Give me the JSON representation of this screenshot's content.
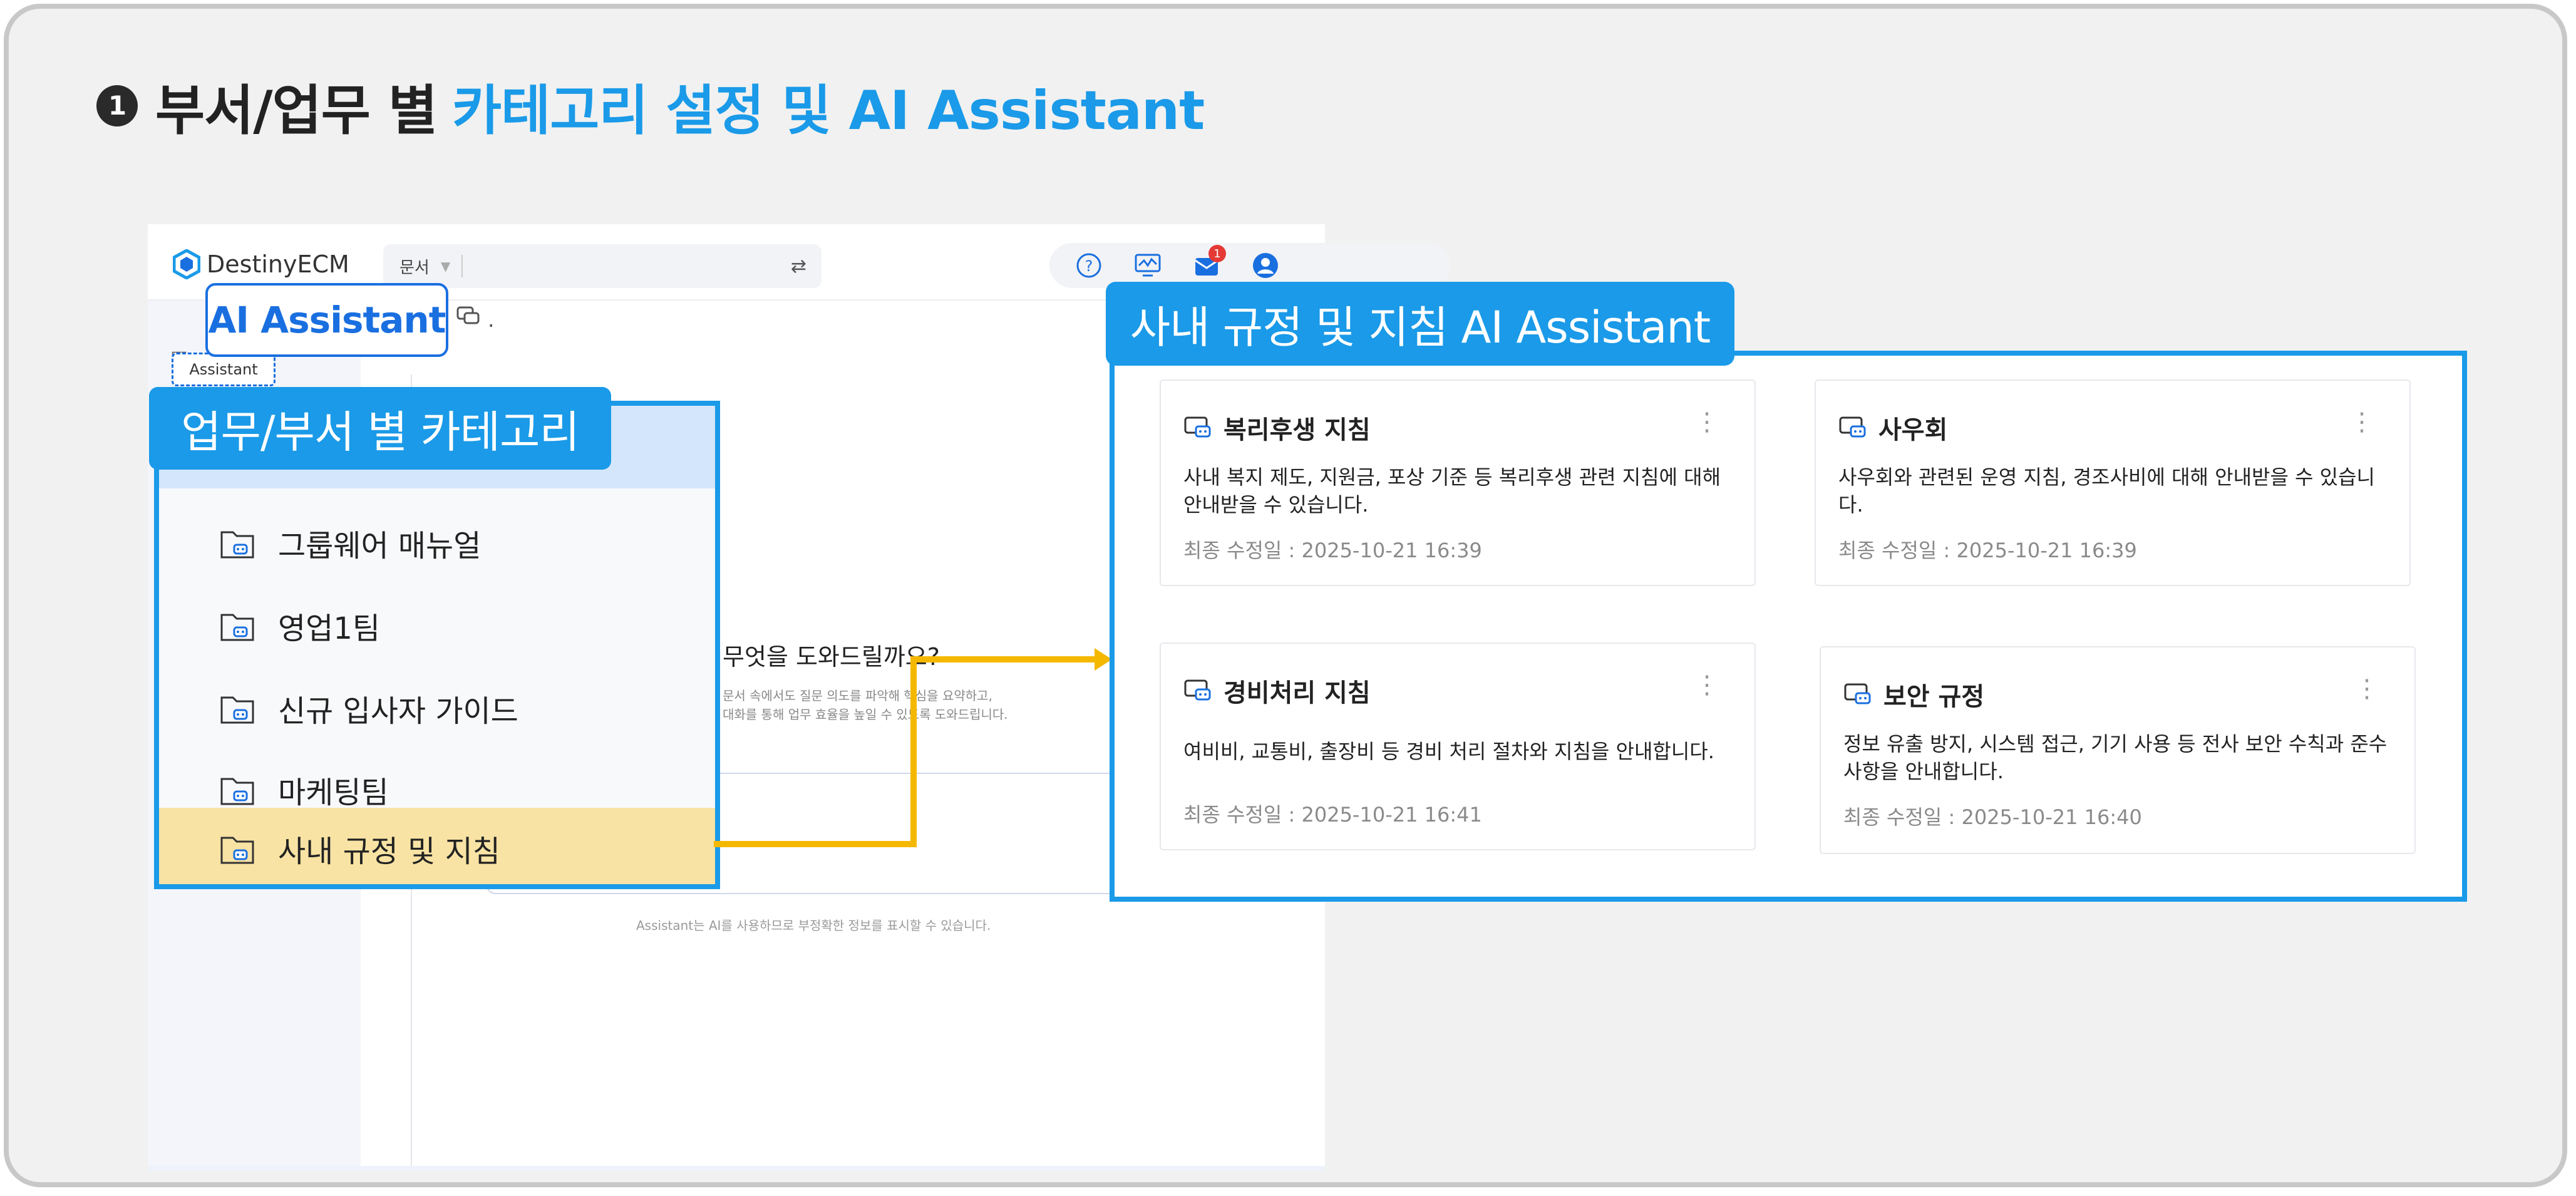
{
  "heading": {
    "number": "1",
    "title_plain": "부서/업무 별",
    "title_accent": "카테고리 설정 및 AI Assistant"
  },
  "app": {
    "logo": "DestinyECM",
    "search_scope": "문서",
    "notification_count": "1",
    "assistant_nav_label": "Assistant",
    "chat_trailing": "."
  },
  "assistant": {
    "question": "무엇을 도와드릴까요?",
    "sub1": "문서 속에서도 질문 의도를 파악해 핵심을 요약하고,",
    "sub2": "대화를 통해 업무 효율을 높일 수 있도록 도와드립니다.",
    "disclaimer": "Assistant는 AI를 사용하므로 부정확한 정보를 표시할 수 있습니다."
  },
  "ai_label": "AI Assistant",
  "category_panel": {
    "title": "업무/부서 별 카테고리",
    "items": [
      "그룹웨어 매뉴얼",
      "영업1팀",
      "신규 입사자 가이드",
      "마케팅팀",
      "사내 규정 및 지침"
    ],
    "selected_index": 4
  },
  "rules_panel": {
    "title": "사내 규정 및 지침 AI Assistant",
    "cards": [
      {
        "title": "복리후생 지침",
        "desc_line1": "사내 복지 제도, 지원금, 포상 기준 등 복리후생 관련 지침에 대해",
        "desc_line2": "안내받을 수 있습니다.",
        "modified": "최종 수정일 : 2025-10-21 16:39"
      },
      {
        "title": "사우회",
        "desc_line1": "사우회와 관련된 운영 지침, 경조사비에 대해 안내받을 수 있습니",
        "desc_line2": "다.",
        "modified": "최종 수정일 : 2025-10-21 16:39"
      },
      {
        "title": "경비처리 지침",
        "desc_line1": "여비비, 교통비, 출장비 등 경비 처리 절차와 지침을 안내합니다.",
        "desc_line2": "",
        "modified": "최종 수정일 : 2025-10-21 16:41"
      },
      {
        "title": "보안 규정",
        "desc_line1": "정보 유출 방지, 시스템 접근, 기기 사용 등 전사 보안 수칙과 준수",
        "desc_line2": "사항을 안내합니다.",
        "modified": "최종 수정일 : 2025-10-21 16:40"
      }
    ]
  },
  "colors": {
    "accent": "#1a9ae8",
    "brand_blue": "#1a6fe0",
    "selected_bg": "#f8e3a4",
    "connector": "#f5b800"
  },
  "icons": [
    "help-icon",
    "monitor-icon",
    "inbox-icon",
    "user-icon",
    "folder-bot-icon",
    "chat-bot-icon",
    "more-icon",
    "filter-icon"
  ]
}
